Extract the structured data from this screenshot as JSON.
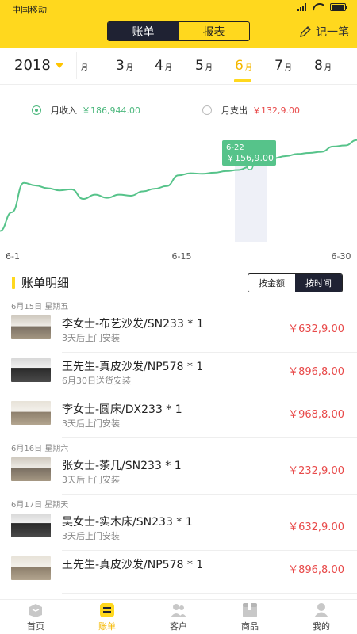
{
  "status": {
    "carrier": "中国移动"
  },
  "header": {
    "segments": [
      "账单",
      "报表"
    ],
    "active_segment": 0,
    "record_label": "记一笔"
  },
  "date_nav": {
    "year": "2018",
    "months": [
      {
        "num": "",
        "unit": "月"
      },
      {
        "num": "3",
        "unit": "月"
      },
      {
        "num": "4",
        "unit": "月"
      },
      {
        "num": "5",
        "unit": "月"
      },
      {
        "num": "6",
        "unit": "月"
      },
      {
        "num": "7",
        "unit": "月"
      },
      {
        "num": "8",
        "unit": "月"
      }
    ],
    "active_month_index": 4
  },
  "legend": {
    "income_label": "月收入",
    "income_value": "￥186,944.00",
    "expense_label": "月支出",
    "expense_value": "￥132,9.00"
  },
  "chart_data": {
    "type": "line",
    "x_ticks": [
      "6-1",
      "6-15",
      "6-30"
    ],
    "highlight": {
      "date": "6-22",
      "value": "￥156,9.00"
    },
    "series": [
      {
        "values": [
          20,
          55,
          110,
          105,
          100,
          96,
          98,
          80,
          88,
          82,
          88,
          86,
          94,
          99,
          104,
          124,
          128,
          127,
          129,
          132,
          134,
          140,
          152,
          156,
          160,
          164,
          166,
          168,
          178,
          180,
          190
        ]
      }
    ],
    "color": "#56C38A"
  },
  "detail": {
    "title": "账单明细",
    "sort_options": [
      "按金额",
      "按时间"
    ],
    "active_sort": 1
  },
  "groups": [
    {
      "date": "6月15日  星期五",
      "items": [
        {
          "title": "李女士-布艺沙发/SN233 * 1",
          "sub": "3天后上门安装",
          "price": "￥632,9.00"
        },
        {
          "title": "王先生-真皮沙发/NP578 * 1",
          "sub": "6月30日送货安装",
          "price": "￥896,8.00"
        },
        {
          "title": "李女士-圆床/DX233 * 1",
          "sub": "3天后上门安装",
          "price": "￥968,8.00"
        }
      ]
    },
    {
      "date": "6月16日  星期六",
      "items": [
        {
          "title": "张女士-茶几/SN233 * 1",
          "sub": "3天后上门安装",
          "price": "￥232,9.00"
        }
      ]
    },
    {
      "date": "6月17日  星期天",
      "items": [
        {
          "title": "吴女士-实木床/SN233 * 1",
          "sub": "3天后上门安装",
          "price": "￥632,9.00"
        },
        {
          "title": "王先生-真皮沙发/NP578 * 1",
          "sub": "",
          "price": "￥896,8.00"
        }
      ]
    }
  ],
  "tabbar": {
    "tabs": [
      "首页",
      "账单",
      "客户",
      "商品",
      "我的"
    ],
    "active_tab": 1
  }
}
